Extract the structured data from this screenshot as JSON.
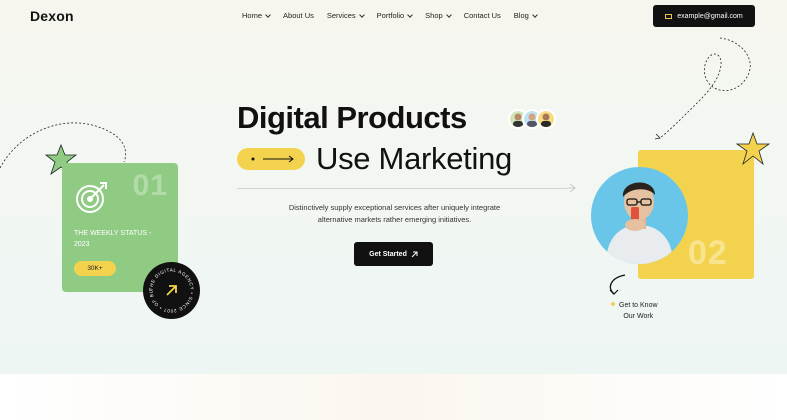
{
  "brand": {
    "logo": "Dexon"
  },
  "nav": {
    "items": [
      {
        "label": "Home",
        "has_dropdown": true
      },
      {
        "label": "About Us",
        "has_dropdown": false
      },
      {
        "label": "Services",
        "has_dropdown": true
      },
      {
        "label": "Portfolio",
        "has_dropdown": true
      },
      {
        "label": "Shop",
        "has_dropdown": true
      },
      {
        "label": "Contact Us",
        "has_dropdown": false
      },
      {
        "label": "Blog",
        "has_dropdown": true
      }
    ],
    "email": "example@gmail.com"
  },
  "hero": {
    "title_line1": "Digital Products",
    "title_line2": "Use Marketing",
    "description": "Distinctively supply exceptional services after uniquely integrate alternative markets rather emerging initiatives.",
    "cta_label": "Get Started"
  },
  "left_card": {
    "number": "01",
    "status": "THE WEEKLY STATUS - 2023",
    "badge": "30K+",
    "icon": "target-icon"
  },
  "circle_badge": {
    "text": "THE DIGITAL AGENCY • SINCE 2007 • OF BUSINESS •"
  },
  "right_card": {
    "number": "02",
    "caption_line1": "Get to Know",
    "caption_line2": "Our Work"
  },
  "colors": {
    "accent_yellow": "#f3d34e",
    "accent_green": "#8fcb83",
    "accent_blue": "#6ac6e8",
    "dark": "#111111"
  }
}
